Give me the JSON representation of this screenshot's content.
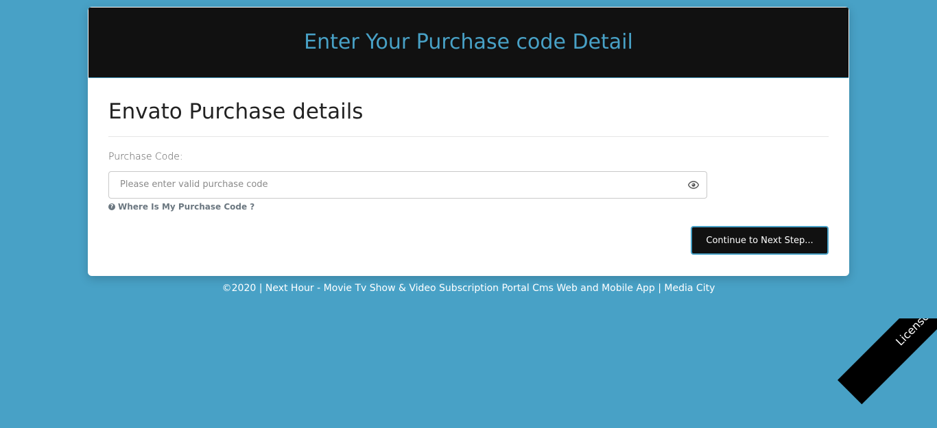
{
  "header": {
    "title": "Enter Your Purchase code Detail"
  },
  "form": {
    "section_title": "Envato Purchase details",
    "purchase_code_label": "Purchase Code:",
    "purchase_code_placeholder": "Please enter valid purchase code",
    "purchase_code_value": "",
    "help_link_text": "Where Is My Purchase Code ?",
    "submit_label": "Continue to Next Step..."
  },
  "footer": {
    "text": "©2020 | Next Hour - Movie Tv Show & Video Subscription Portal Cms Web and Mobile App | Media City"
  },
  "ribbon": {
    "label": "License"
  },
  "colors": {
    "page_background": "#48a1c6",
    "header_background": "#111111",
    "accent": "#48a1c6",
    "button_background": "#111111"
  },
  "icons": {
    "password_toggle": "eye-icon",
    "help": "question-circle-icon"
  }
}
